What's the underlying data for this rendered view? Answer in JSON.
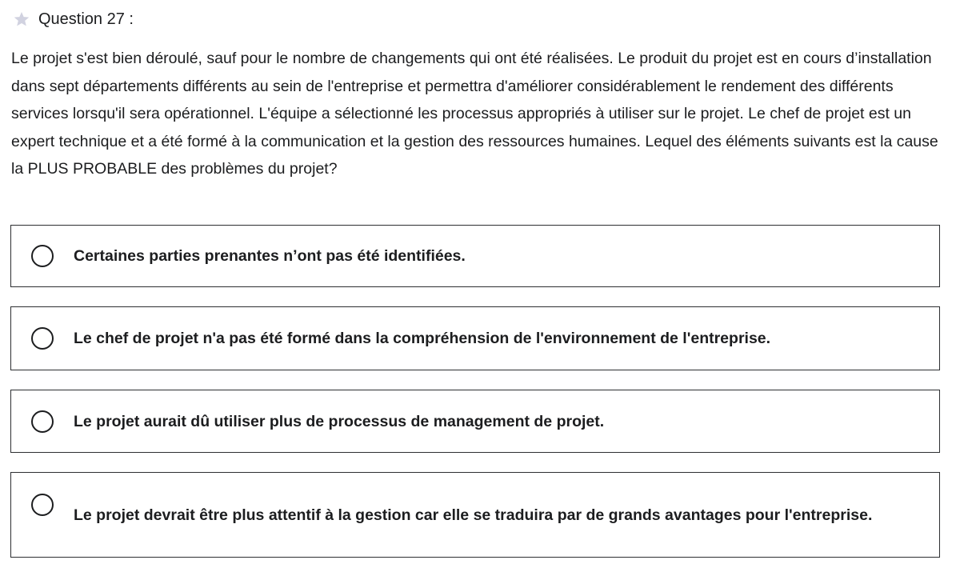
{
  "question": {
    "number_label": "Question 27 :",
    "text": "Le projet s'est bien déroulé, sauf pour le nombre de changements qui ont été réalisées. Le produit du projet est en cours d’installation dans sept départements différents au sein de l'entreprise et permettra d'améliorer considérablement le rendement des différents services lorsqu'il sera opérationnel. L'équipe a sélectionné les processus appropriés à utiliser sur le projet. Le chef de projet est un expert technique et a été formé à la communication et la gestion des ressources humaines. Lequel des éléments suivants est la cause la PLUS PROBABLE des problèmes du projet?"
  },
  "answers": [
    {
      "label": "Certaines parties prenantes n’ont pas été identifiées."
    },
    {
      "label": "Le chef de projet n'a pas été formé dans la compréhension de l'environnement de l'entreprise."
    },
    {
      "label": "Le projet aurait dû utiliser plus de processus de management de projet."
    },
    {
      "label": "Le projet devrait être plus attentif à la gestion car elle se traduira par de grands avantages pour l'entreprise."
    }
  ],
  "icons": {
    "star": "star-icon",
    "radio": "radio-button-unchecked"
  },
  "colors": {
    "text": "#1c1d1f",
    "border": "#2d2f31",
    "star": "#d1d2e0"
  }
}
